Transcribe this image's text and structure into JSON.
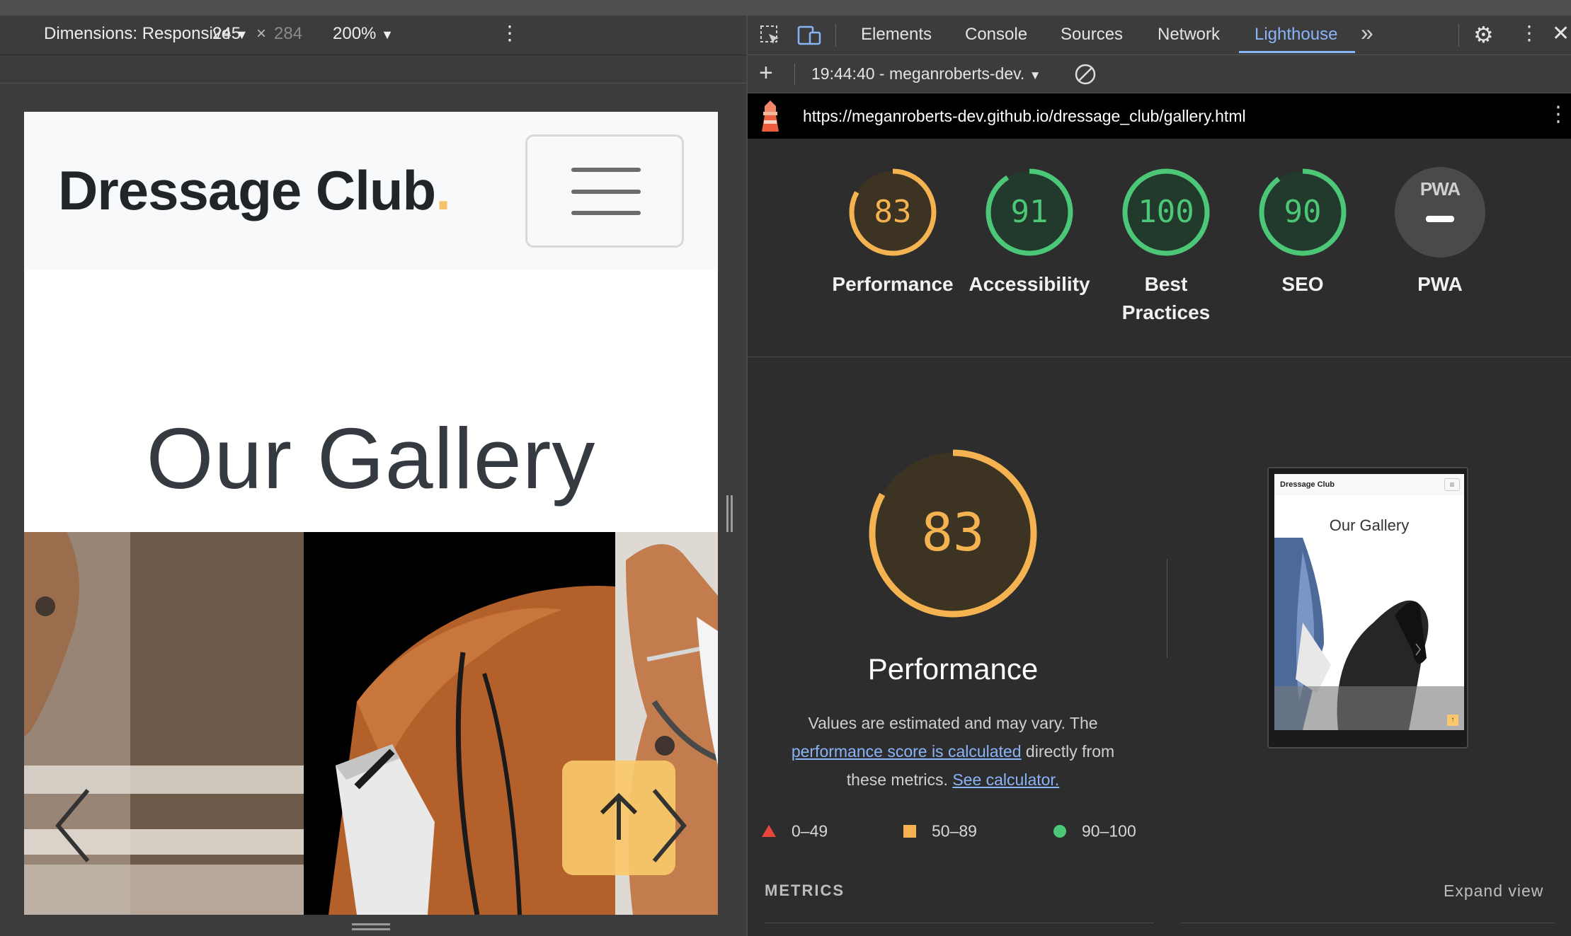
{
  "device_toolbar": {
    "dimensions_label": "Dimensions: Responsive",
    "width": "245",
    "times": "×",
    "height": "284",
    "zoom": "200%"
  },
  "devtools": {
    "tabs": [
      {
        "label": "Elements"
      },
      {
        "label": "Console"
      },
      {
        "label": "Sources"
      },
      {
        "label": "Network"
      },
      {
        "label": "Lighthouse"
      }
    ],
    "more_tabs": "»",
    "report_selector": "19:44:40 - meganroberts-dev.",
    "url": "https://meganroberts-dev.github.io/dressage_club/gallery.html"
  },
  "site": {
    "brand": "Dressage Club",
    "brand_dot": ".",
    "gallery_title": "Our Gallery"
  },
  "lighthouse": {
    "scores": [
      {
        "label_1": "Performance",
        "label_2": "",
        "score": 83,
        "fraction": 0.83,
        "color": "#f4b350"
      },
      {
        "label_1": "Accessibility",
        "label_2": "",
        "score": 91,
        "fraction": 0.91,
        "color": "#4cc777"
      },
      {
        "label_1": "Best",
        "label_2": "Practices",
        "score": 100,
        "fraction": 1.0,
        "color": "#4cc777"
      },
      {
        "label_1": "SEO",
        "label_2": "",
        "score": 90,
        "fraction": 0.9,
        "color": "#4cc777"
      },
      {
        "label_1": "PWA",
        "label_2": "",
        "score": null,
        "fraction": 0,
        "color": "#9e9e9e"
      }
    ],
    "pwa_badge": "PWA",
    "big_score": 83,
    "big_label": "Performance",
    "note_1": "Values are estimated and may vary. The",
    "note_link": "performance score is calculated",
    "note_2": "directly from",
    "note_3": "these metrics.",
    "note_link2": "See calculator.",
    "legend": [
      {
        "range": "0–49",
        "color": "#e8453c"
      },
      {
        "range": "50–89",
        "color": "#f4b350"
      },
      {
        "range": "90–100",
        "color": "#4cc777"
      }
    ],
    "metrics_heading": "METRICS",
    "expand_label": "Expand view",
    "thumb_brand": "Dressage Club",
    "thumb_title": "Our Gallery"
  }
}
